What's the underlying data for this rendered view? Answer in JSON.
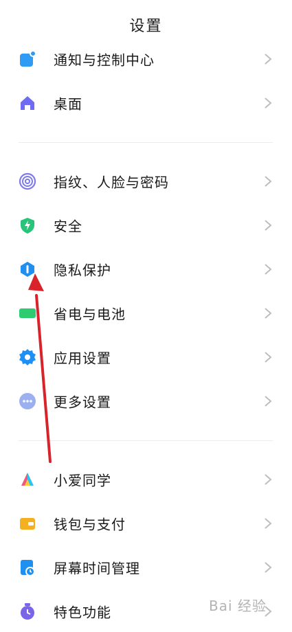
{
  "header": {
    "title": "设置"
  },
  "settings": {
    "items": [
      {
        "label": "通知与控制中心",
        "icon": "notification-icon",
        "color": "#2f9bf5"
      },
      {
        "label": "桌面",
        "icon": "home-icon",
        "color": "#6e6cf3"
      },
      {
        "label": "指纹、人脸与密码",
        "icon": "fingerprint-icon",
        "color": "#7d7ae6"
      },
      {
        "label": "安全",
        "icon": "shield-bolt-icon",
        "color": "#27c47a"
      },
      {
        "label": "隐私保护",
        "icon": "privacy-icon",
        "color": "#1f8ff0"
      },
      {
        "label": "省电与电池",
        "icon": "battery-icon",
        "color": "#2ecc71"
      },
      {
        "label": "应用设置",
        "icon": "gear-icon",
        "color": "#1e90f5"
      },
      {
        "label": "更多设置",
        "icon": "more-dots-icon",
        "color": "#9bb0ee"
      },
      {
        "label": "小爱同学",
        "icon": "xiaoai-icon",
        "color": "#f05a7a"
      },
      {
        "label": "钱包与支付",
        "icon": "wallet-icon",
        "color": "#f5b021"
      },
      {
        "label": "屏幕时间管理",
        "icon": "screen-time-icon",
        "color": "#1f8ff0"
      },
      {
        "label": "特色功能",
        "icon": "special-feature-icon",
        "color": "#7a64e8"
      }
    ]
  },
  "annotation": {
    "arrow_color": "#d8232a"
  },
  "watermark": {
    "text": "Bai 经验"
  }
}
